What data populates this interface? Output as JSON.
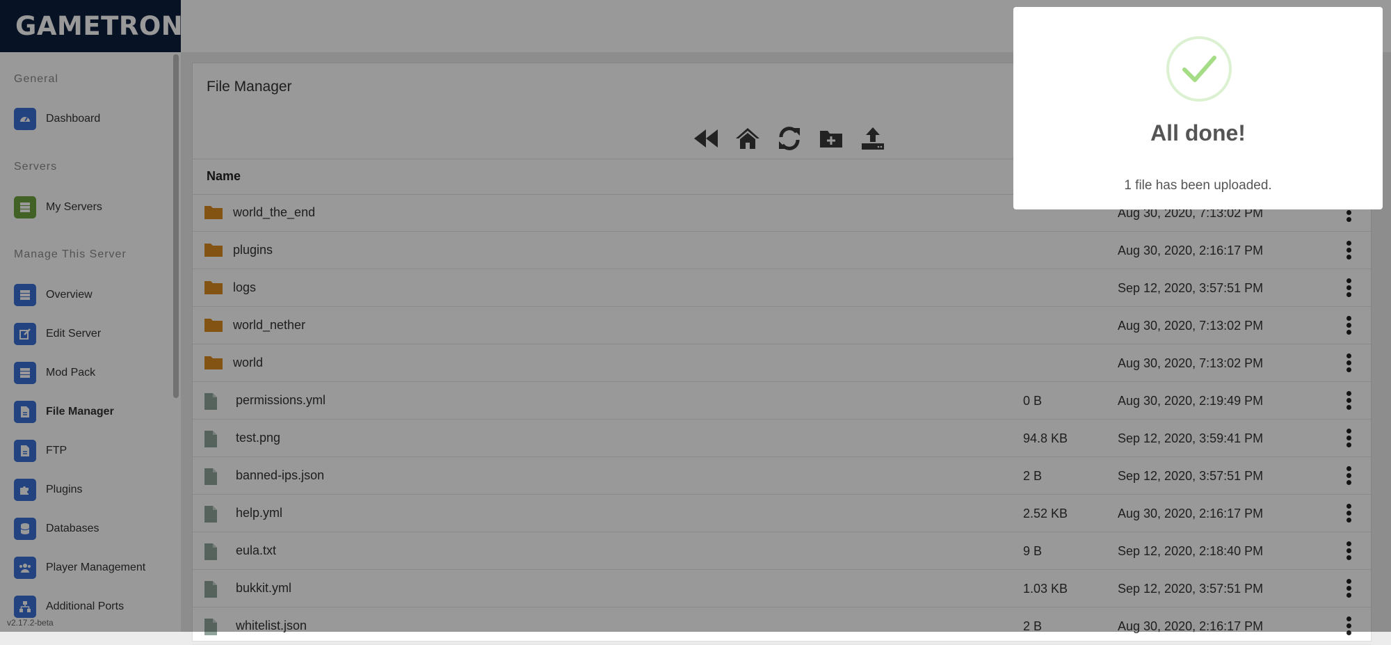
{
  "app": {
    "logo_text": "GAMETRON",
    "version": "v2.17.2-beta"
  },
  "sidebar": {
    "sections": [
      {
        "label": "General"
      },
      {
        "label": "Servers"
      },
      {
        "label": "Manage This Server"
      }
    ],
    "items": [
      {
        "label": "Dashboard",
        "icon": "dashboard-icon"
      },
      {
        "label": "My Servers",
        "icon": "server-icon"
      },
      {
        "label": "Overview",
        "icon": "server-icon"
      },
      {
        "label": "Edit Server",
        "icon": "edit-icon"
      },
      {
        "label": "Mod Pack",
        "icon": "server-icon"
      },
      {
        "label": "File Manager",
        "icon": "file-icon",
        "active": true
      },
      {
        "label": "FTP",
        "icon": "file-icon"
      },
      {
        "label": "Plugins",
        "icon": "puzzle-icon"
      },
      {
        "label": "Databases",
        "icon": "database-icon"
      },
      {
        "label": "Player Management",
        "icon": "users-icon"
      },
      {
        "label": "Additional Ports",
        "icon": "network-icon"
      }
    ]
  },
  "file_manager": {
    "title": "File Manager",
    "toolbar": [
      "back-icon",
      "home-icon",
      "refresh-icon",
      "new-folder-icon",
      "upload-icon"
    ],
    "column_name": "Name",
    "rows": [
      {
        "name": "world_the_end",
        "type": "folder",
        "size": "",
        "date": "Aug 30, 2020, 7:13:02 PM"
      },
      {
        "name": "plugins",
        "type": "folder",
        "size": "",
        "date": "Aug 30, 2020, 2:16:17 PM"
      },
      {
        "name": "logs",
        "type": "folder",
        "size": "",
        "date": "Sep 12, 2020, 3:57:51 PM"
      },
      {
        "name": "world_nether",
        "type": "folder",
        "size": "",
        "date": "Aug 30, 2020, 7:13:02 PM"
      },
      {
        "name": "world",
        "type": "folder",
        "size": "",
        "date": "Aug 30, 2020, 7:13:02 PM"
      },
      {
        "name": "permissions.yml",
        "type": "file",
        "size": "0 B",
        "date": "Aug 30, 2020, 2:19:49 PM"
      },
      {
        "name": "test.png",
        "type": "file",
        "size": "94.8 KB",
        "date": "Sep 12, 2020, 3:59:41 PM"
      },
      {
        "name": "banned-ips.json",
        "type": "file",
        "size": "2 B",
        "date": "Sep 12, 2020, 3:57:51 PM"
      },
      {
        "name": "help.yml",
        "type": "file",
        "size": "2.52 KB",
        "date": "Aug 30, 2020, 2:16:17 PM"
      },
      {
        "name": "eula.txt",
        "type": "file",
        "size": "9 B",
        "date": "Sep 12, 2020, 2:18:40 PM"
      },
      {
        "name": "bukkit.yml",
        "type": "file",
        "size": "1.03 KB",
        "date": "Sep 12, 2020, 3:57:51 PM"
      },
      {
        "name": "whitelist.json",
        "type": "file",
        "size": "2 B",
        "date": "Aug 30, 2020, 2:16:17 PM"
      }
    ]
  },
  "toast": {
    "title": "All done!",
    "message": "1 file has been uploaded."
  },
  "colors": {
    "navy": "#0d1f3c",
    "accent": "#3b6fd6",
    "folder": "#d98b1f",
    "file": "#8fa39a",
    "success": "#a5dc86"
  }
}
